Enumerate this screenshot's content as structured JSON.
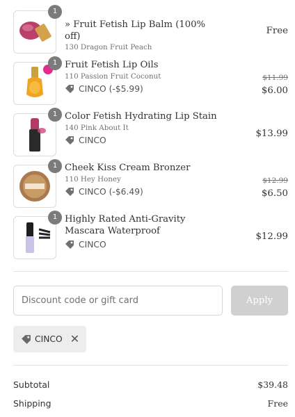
{
  "cart": {
    "items": [
      {
        "quantity": "1",
        "name": "» Fruit Fetish Lip Balm (100% off)",
        "variant": "130 Dragon Fruit Peach",
        "discount": "",
        "original_price": "",
        "price": "Free",
        "image_icon": "lip-balm-product-image"
      },
      {
        "quantity": "1",
        "name": "Fruit Fetish Lip Oils",
        "variant": "110 Passion Fruit Coconut",
        "discount": "CINCO (-$5.99)",
        "original_price": "$11.99",
        "price": "$6.00",
        "image_icon": "lip-oil-product-image"
      },
      {
        "quantity": "1",
        "name": "Color Fetish Hydrating Lip Stain",
        "variant": "140 Pink About It",
        "discount": "CINCO",
        "original_price": "",
        "price": "$13.99",
        "image_icon": "lip-stain-product-image"
      },
      {
        "quantity": "1",
        "name": "Cheek Kiss Cream Bronzer",
        "variant": "110 Hey Honey",
        "discount": "CINCO (-$6.49)",
        "original_price": "$12.99",
        "price": "$6.50",
        "image_icon": "bronzer-product-image"
      },
      {
        "quantity": "1",
        "name": "Highly Rated Anti-Gravity Mascara Waterproof",
        "variant": "",
        "discount": "CINCO",
        "original_price": "",
        "price": "$12.99",
        "image_icon": "mascara-product-image"
      }
    ]
  },
  "discount_form": {
    "placeholder": "Discount code or gift card",
    "apply_label": "Apply"
  },
  "applied_code": {
    "code": "CINCO",
    "remove_icon": "close-icon"
  },
  "summary": {
    "subtotal_label": "Subtotal",
    "subtotal_value": "$39.48",
    "shipping_label": "Shipping",
    "shipping_value": "Free"
  },
  "colors": {
    "badge": "#7b7b7b",
    "apply_disabled": "#d0d0d0",
    "chip_bg": "#ededed",
    "muted_text": "#707070"
  }
}
